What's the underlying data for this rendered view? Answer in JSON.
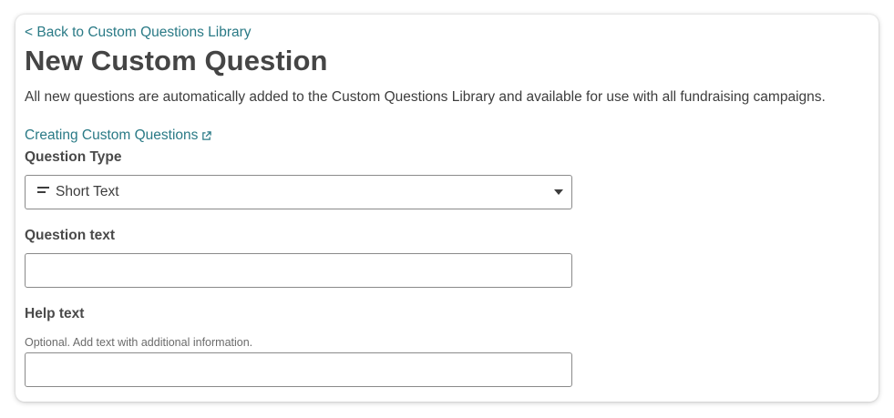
{
  "nav": {
    "back_label": "< Back to Custom Questions Library"
  },
  "header": {
    "title": "New Custom Question",
    "description": "All new questions are automatically added to the Custom Questions Library and available for use with all fundraising campaigns."
  },
  "help_link": {
    "label": "Creating Custom Questions",
    "icon": "external-link-icon"
  },
  "form": {
    "question_type": {
      "label": "Question Type",
      "value": "Short Text",
      "icon": "short-text-icon"
    },
    "question_text": {
      "label": "Question text",
      "value": "",
      "placeholder": ""
    },
    "help_text": {
      "label": "Help text",
      "hint": "Optional. Add text with additional information.",
      "value": "",
      "placeholder": ""
    }
  },
  "colors": {
    "link": "#2a7a86",
    "text": "#3d3d3d",
    "border": "#8a8a8a"
  }
}
